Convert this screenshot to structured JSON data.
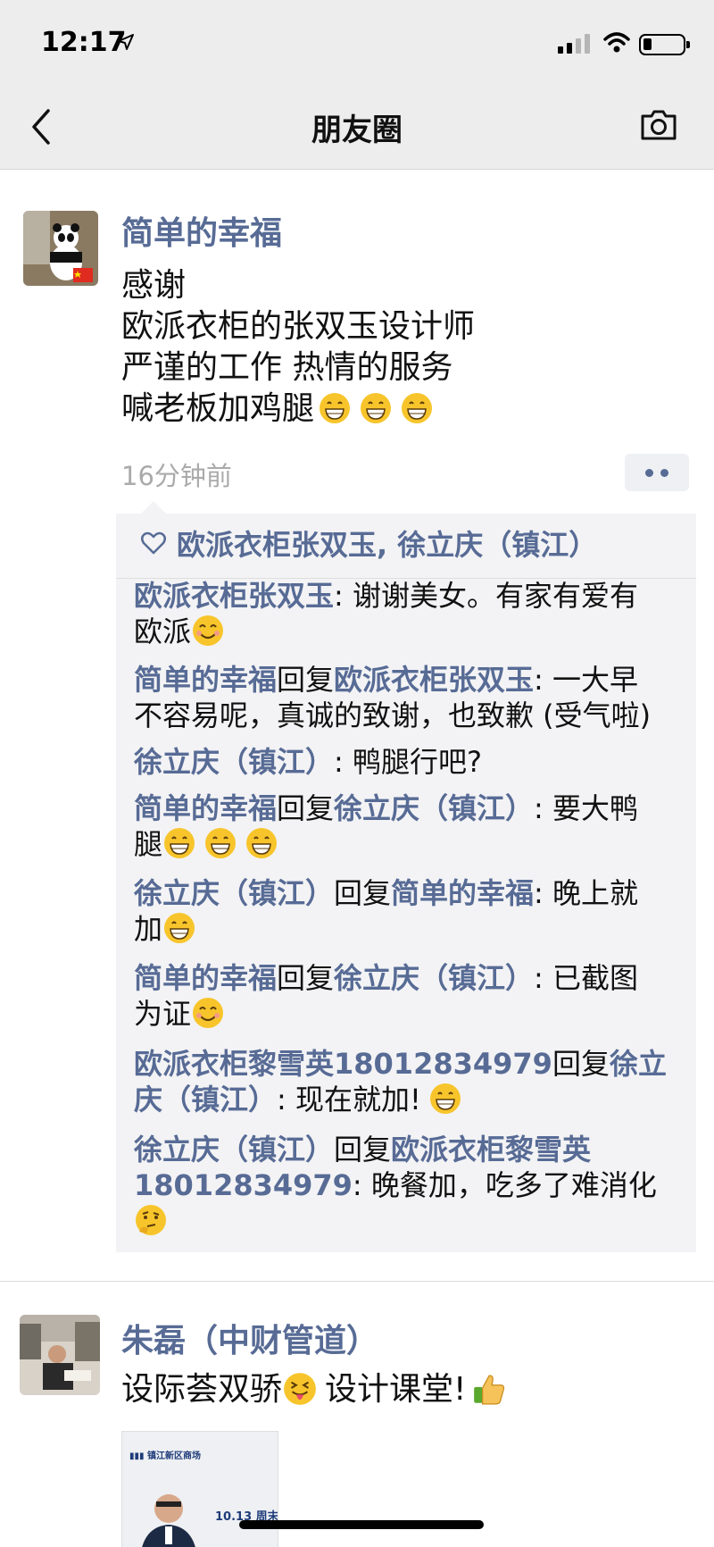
{
  "status_bar": {
    "time": "12:17"
  },
  "nav": {
    "title": "朋友圈",
    "back_icon": "chevron-left-icon",
    "camera_icon": "camera-icon"
  },
  "post1": {
    "author": "简单的幸福",
    "lines": [
      "感谢",
      "欧派衣柜的张双玉设计师",
      "严谨的工作 热情的服务",
      "喊老板加鸡腿"
    ],
    "time_ago": "16分钟前",
    "likes": "欧派衣柜张双玉, 徐立庆（镇江）",
    "comments": {
      "c1": {
        "user": "欧派衣柜张双玉",
        "text_a": ": 谢谢美女。有家有爱有",
        "text_b": "欧派"
      },
      "c2": {
        "user": "简单的幸福",
        "reply": "回复",
        "target": "欧派衣柜张双玉",
        "text_a": ": 一大早",
        "text_b": "不容易呢，真诚的致谢，也致歉 (受气啦)"
      },
      "c3": {
        "user": "徐立庆（镇江）",
        "text_a": ": 鸭腿行吧?"
      },
      "c4": {
        "user": "简单的幸福",
        "reply": "回复",
        "target": "徐立庆（镇江）",
        "text_a": ": 要大鸭",
        "text_b": "腿"
      },
      "c5": {
        "user": "徐立庆（镇江）",
        "reply": "回复",
        "target": "简单的幸福",
        "text_a": ": 晚上就",
        "text_b": "加"
      },
      "c6": {
        "user": "简单的幸福",
        "reply": "回复",
        "target": "徐立庆（镇江）",
        "text_a": ": 已截图",
        "text_b": "为证"
      },
      "c7": {
        "user": "欧派衣柜黎雪英18012834979",
        "reply": "回复",
        "target_a": "徐立",
        "target_b": "庆（镇江）",
        "text_b": ": 现在就加!"
      },
      "c8": {
        "user_a": "徐立庆（镇江）",
        "reply": "回复",
        "target_a": "欧派衣柜黎雪英",
        "target_b": "18012834979",
        "text_b": ": 晚餐加，吃多了难消化"
      }
    }
  },
  "post2": {
    "author": "朱磊（中财管道）",
    "text_a": "设际荟双骄",
    "text_b": "设计课堂!",
    "thumbnail": {
      "brand": "镇江新区商场",
      "event_date": "10.13 周末"
    }
  }
}
